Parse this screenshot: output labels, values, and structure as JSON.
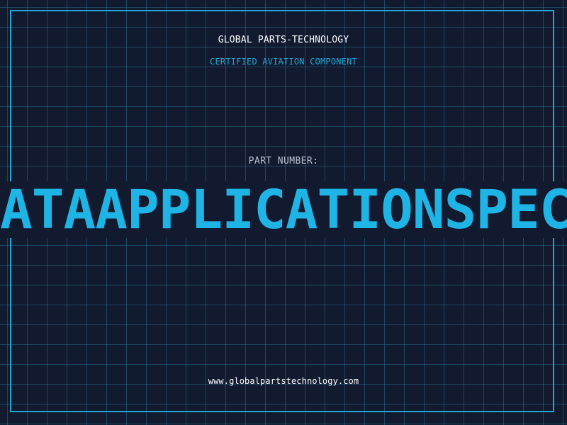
{
  "header": {
    "company": "GLOBAL PARTS-TECHNOLOGY",
    "subtitle": "CERTIFIED AVIATION COMPONENT"
  },
  "part": {
    "label": "PART NUMBER:",
    "value": "ATAAPPLICATIONSPEC"
  },
  "footer": {
    "url": "www.globalpartstechnology.com"
  },
  "colors": {
    "background": "#111a2e",
    "grid": "#286e8c",
    "frame": "#22a7d0",
    "accent": "#1fb4e6",
    "label": "#b9c3cf",
    "text": "#ffffff"
  }
}
